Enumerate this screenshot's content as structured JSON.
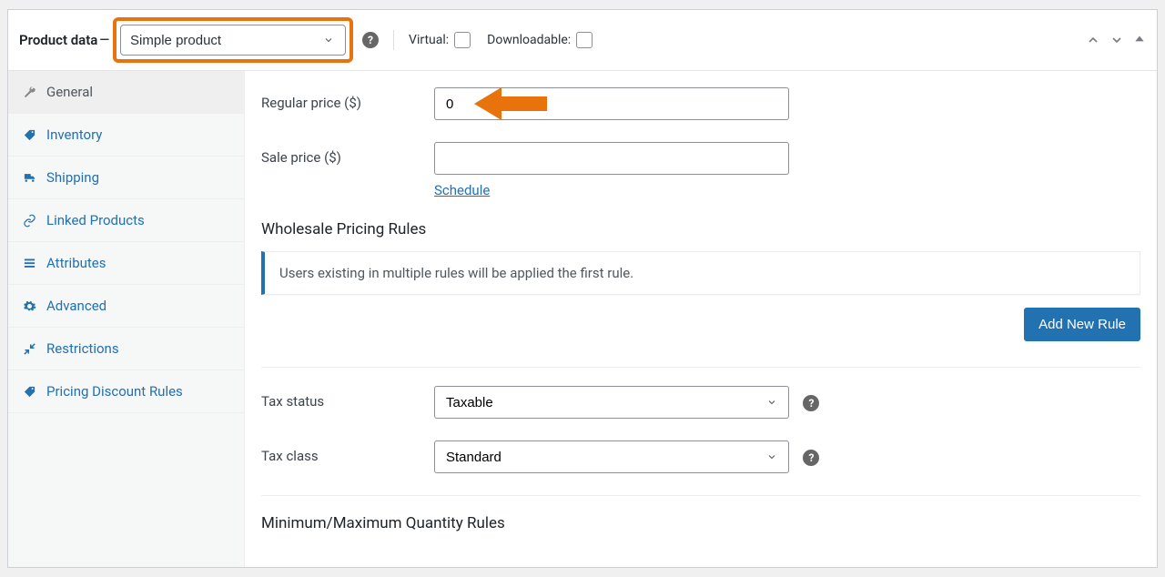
{
  "header": {
    "title": "Product data",
    "product_type_selected": "Simple product",
    "virtual_label": "Virtual:",
    "downloadable_label": "Downloadable:"
  },
  "tabs": [
    {
      "key": "general",
      "label": "General",
      "active": true,
      "icon": "wrench"
    },
    {
      "key": "inventory",
      "label": "Inventory",
      "active": false,
      "icon": "tag"
    },
    {
      "key": "shipping",
      "label": "Shipping",
      "active": false,
      "icon": "truck"
    },
    {
      "key": "linked",
      "label": "Linked Products",
      "active": false,
      "icon": "link"
    },
    {
      "key": "attributes",
      "label": "Attributes",
      "active": false,
      "icon": "list"
    },
    {
      "key": "advanced",
      "label": "Advanced",
      "active": false,
      "icon": "gear"
    },
    {
      "key": "restrictions",
      "label": "Restrictions",
      "active": false,
      "icon": "compress"
    },
    {
      "key": "pricing",
      "label": "Pricing Discount Rules",
      "active": false,
      "icon": "pricetag"
    }
  ],
  "general": {
    "regular_price_label": "Regular price ($)",
    "regular_price_value": "0",
    "sale_price_label": "Sale price ($)",
    "sale_price_value": "",
    "schedule_link": "Schedule",
    "wholesale_heading": "Wholesale Pricing Rules",
    "wholesale_notice": "Users existing in multiple rules will be applied the first rule.",
    "add_rule_btn": "Add New Rule",
    "tax_status_label": "Tax status",
    "tax_status_value": "Taxable",
    "tax_class_label": "Tax class",
    "tax_class_value": "Standard",
    "minmax_heading": "Minimum/Maximum Quantity Rules"
  }
}
